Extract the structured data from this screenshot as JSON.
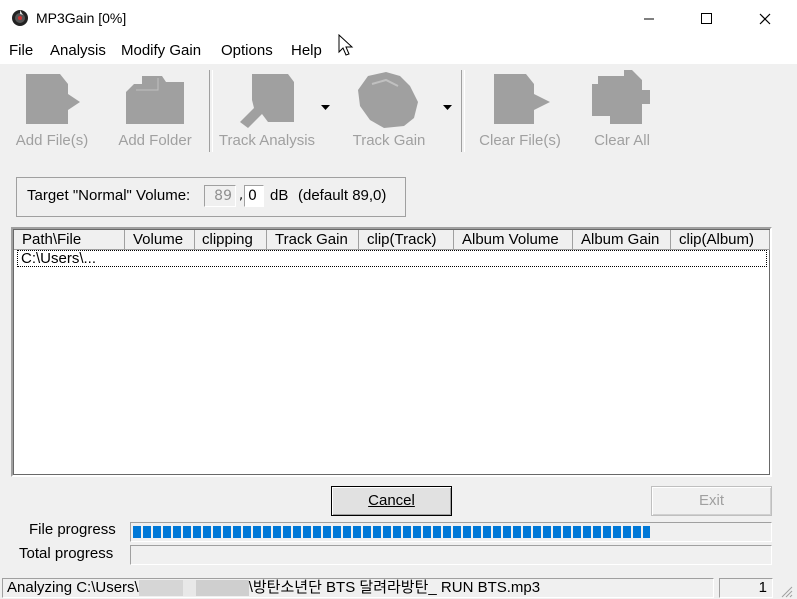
{
  "window": {
    "title": "MP3Gain [0%]"
  },
  "menu": [
    "File",
    "Analysis",
    "Modify Gain",
    "Options",
    "Help"
  ],
  "toolbar": {
    "add_files": "Add File(s)",
    "add_folder": "Add Folder",
    "track_analysis": "Track Analysis",
    "track_gain": "Track Gain",
    "clear_files": "Clear File(s)",
    "clear_all": "Clear All"
  },
  "target": {
    "label": "Target \"Normal\" Volume:",
    "int_value": "89",
    "dec_value": "0",
    "unit": "dB",
    "default_text": "(default 89,0)"
  },
  "list": {
    "columns": [
      "Path\\File",
      "Volume",
      "clipping",
      "Track Gain",
      "clip(Track)",
      "Album Volume",
      "Album Gain",
      "clip(Album)"
    ],
    "rows": [
      [
        "C:\\Users\\..."
      ]
    ]
  },
  "buttons": {
    "cancel": "Cancel",
    "exit": "Exit"
  },
  "progress": {
    "file_label": "File progress",
    "total_label": "Total progress",
    "file_fraction": 0.81,
    "total_fraction": 0.0
  },
  "status": {
    "text_prefix": "Analyzing C:\\Users\\",
    "text_suffix": "\\방탄소년단 BTS 달려라방탄_ RUN BTS.mp3",
    "count": "1"
  },
  "colors": {
    "progress": "#0078d7",
    "disabled_text": "#a0a0a0"
  }
}
